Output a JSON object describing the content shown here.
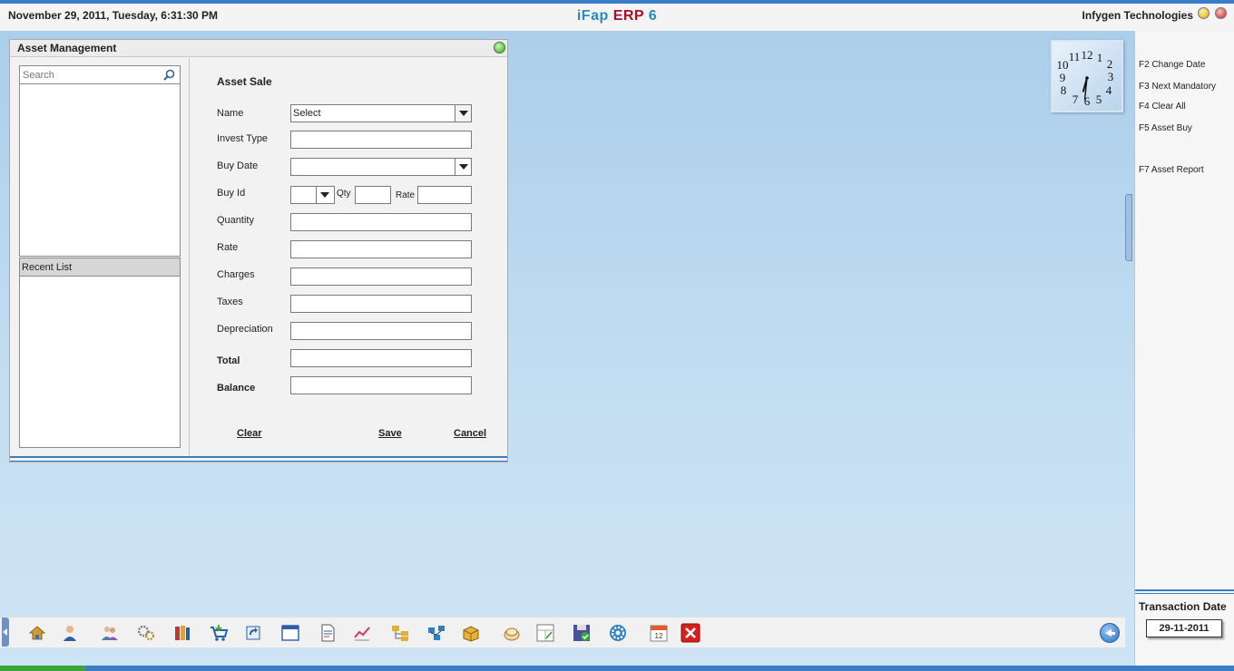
{
  "header": {
    "datetime": "November  29, 2011, Tuesday, 6:31:30 PM",
    "app_title_part1": "iFap",
    "app_title_part2": "ERP",
    "app_title_part3": "6",
    "company": "Infygen Technologies",
    "colors": {
      "accent": "#3b7dc4",
      "title_blue": "#2a8ac9",
      "title_red": "#a5112b"
    }
  },
  "window": {
    "title": "Asset Management",
    "search": {
      "placeholder": "Search",
      "value": ""
    },
    "recent_list_label": "Recent List"
  },
  "form": {
    "title": "Asset Sale",
    "labels": {
      "name": "Name",
      "invest_type": "Invest Type",
      "buy_date": "Buy Date",
      "buy_id": "Buy Id",
      "qty": "Qty",
      "rate_inline": "Rate",
      "quantity": "Quantity",
      "rate": "Rate",
      "charges": "Charges",
      "taxes": "Taxes",
      "depreciation": "Depreciation",
      "total": "Total",
      "balance": "Balance"
    },
    "name_selected": "Select",
    "buttons": {
      "clear": "Clear",
      "save": "Save",
      "cancel": "Cancel"
    }
  },
  "shortcuts": [
    "F2 Change Date",
    "F3 Next Mandatory",
    "F4 Clear All",
    "F5 Asset Buy",
    "F7 Asset Report"
  ],
  "transaction": {
    "label": "Transaction Date",
    "date": "29-11-2011"
  },
  "clock": {
    "hour": 6,
    "minute": 31
  },
  "taskbar_icons": [
    "home-icon",
    "user-phone-icon",
    "people-icon",
    "settings-gears-icon",
    "books-icon",
    "cart-icon",
    "sync-icon",
    "window-icon",
    "document-icon",
    "chart-icon",
    "folder-tree-icon",
    "network-icon",
    "package-icon",
    "coins-icon",
    "calculator-icon",
    "save-check-icon",
    "gear-icon",
    "calendar-icon",
    "close-x-icon",
    "back-arrow-icon"
  ]
}
